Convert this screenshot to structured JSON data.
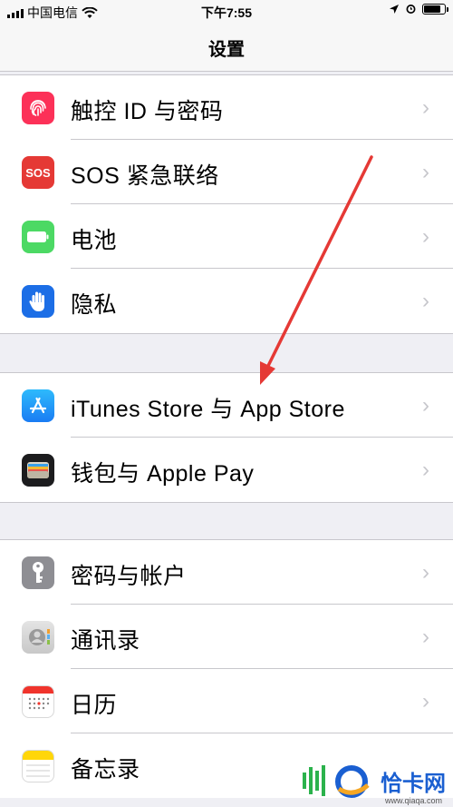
{
  "status_bar": {
    "carrier": "中国电信",
    "time": "下午7:55"
  },
  "nav": {
    "title": "设置"
  },
  "groups": [
    {
      "items": [
        {
          "label": "触控 ID 与密码",
          "icon": "fingerprint-icon",
          "color": "#fc3158"
        },
        {
          "label": "SOS 紧急联络",
          "icon": "sos-icon",
          "icon_text": "SOS",
          "color": "#e53935"
        },
        {
          "label": "电池",
          "icon": "battery-icon",
          "color": "#4cd964"
        },
        {
          "label": "隐私",
          "icon": "hand-icon",
          "color": "#1c6ee6"
        }
      ]
    },
    {
      "items": [
        {
          "label": "iTunes Store 与 App Store",
          "icon": "app-store-icon",
          "color": "#1a9af7"
        },
        {
          "label": "钱包与 Apple Pay",
          "icon": "wallet-icon",
          "color": "#1c1c1e"
        }
      ]
    },
    {
      "items": [
        {
          "label": "密码与帐户",
          "icon": "key-icon",
          "color": "#8e8e93"
        },
        {
          "label": "通讯录",
          "icon": "contacts-icon",
          "color": "#cfcfcf"
        },
        {
          "label": "日历",
          "icon": "calendar-icon",
          "color": "#ffffff"
        },
        {
          "label": "备忘录",
          "icon": "notes-icon",
          "color": "#ffd60a"
        }
      ]
    }
  ],
  "annotation": {
    "arrow_color": "#e53935"
  },
  "watermark": {
    "text": "恰卡网",
    "sub": "www.qiaqa.com"
  }
}
